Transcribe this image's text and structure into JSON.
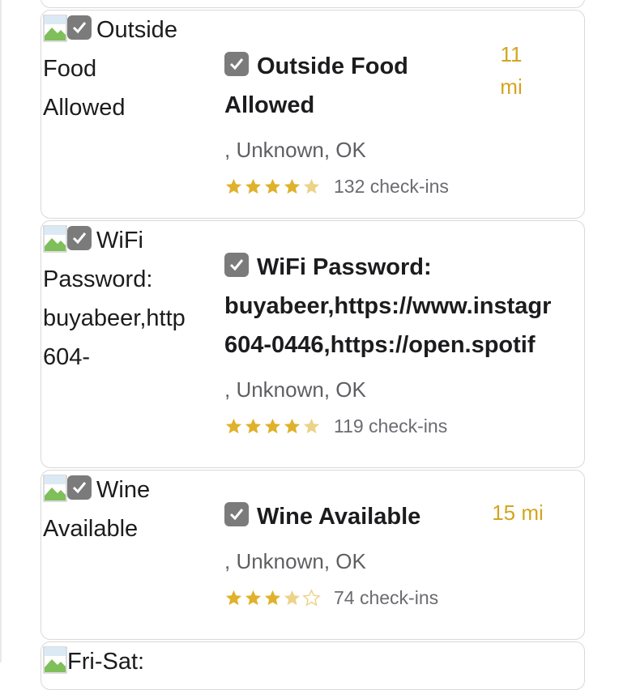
{
  "colors": {
    "accent": "#d4a520",
    "star_full": "#e0b12a",
    "star_light": "#ecd38a",
    "checkbox": "#7b7b7b"
  },
  "venues": [
    {
      "img_alt_lines": [
        "Outside",
        "Food",
        "Allowed"
      ],
      "title_lines": [
        "Outside Food",
        "Allowed"
      ],
      "address": ", Unknown, OK",
      "rating_stars": 4.5,
      "checkins": "132 check-ins",
      "distance_lines": [
        "11",
        "mi"
      ]
    },
    {
      "img_alt_lines": [
        "WiFi",
        "Password:",
        "buyabeer,http",
        "604-"
      ],
      "title_lines": [
        "WiFi Password:",
        "buyabeer,https://www.instagr",
        "604-0446,https://open.spotif"
      ],
      "address": ", Unknown, OK",
      "rating_stars": 4.5,
      "checkins": "119 check-ins"
    },
    {
      "img_alt_lines": [
        "Wine",
        "Available"
      ],
      "title_lines": [
        "Wine Available"
      ],
      "address": ", Unknown, OK",
      "rating_stars": 3.5,
      "checkins": "74 check-ins",
      "distance_lines": [
        "15 mi"
      ]
    },
    {
      "img_alt_lines": [
        "Fri-Sat:"
      ]
    }
  ]
}
